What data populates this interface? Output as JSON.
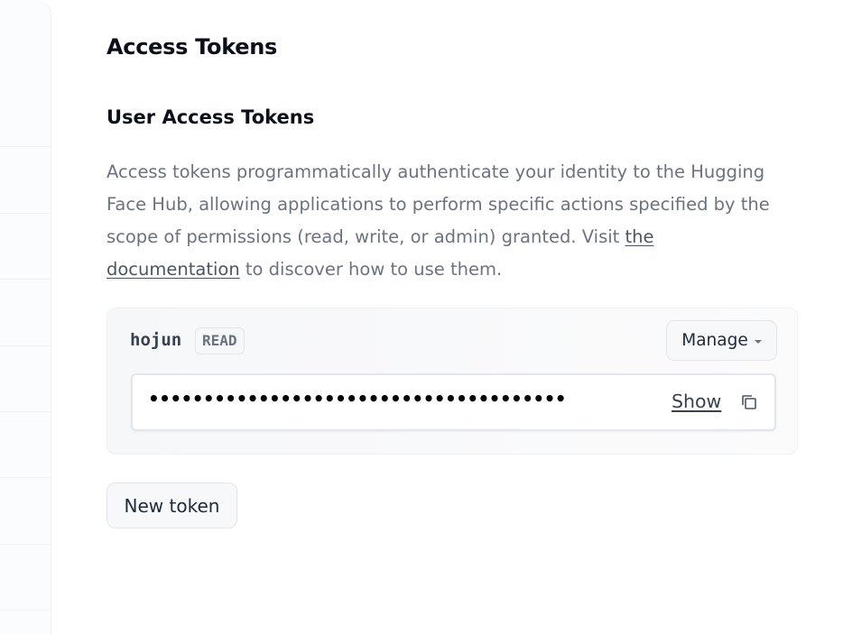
{
  "page": {
    "title": "Access Tokens"
  },
  "section": {
    "title": "User Access Tokens",
    "description_before_link": "Access tokens programmatically authenticate your identity to the Hugging Face Hub, allowing applications to perform specific actions specified by the scope of permissions (read, write, or admin) granted. Visit ",
    "link_text": "the documentation",
    "description_after_link": " to discover how to use them."
  },
  "tokens": [
    {
      "name": "hojun",
      "role": "READ",
      "manage_label": "Manage",
      "masked_value": "••••••••••••••••••••••••••••••••••••••",
      "show_label": "Show",
      "copy_icon": "copy-icon"
    }
  ],
  "actions": {
    "new_token_label": "New token"
  },
  "icons": {
    "manage_caret": "caret-down-icon",
    "copy": "copy-icon"
  },
  "colors": {
    "text_primary": "#0b0f19",
    "text_muted": "#6b7280",
    "border": "#e2e5ea",
    "card_bg": "#f6f7f9"
  }
}
